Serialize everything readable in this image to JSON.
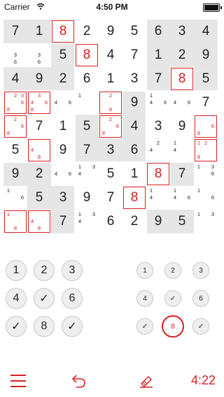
{
  "status": {
    "carrier": "Carrier",
    "time": "4:50 PM"
  },
  "board": {
    "rows": [
      [
        {
          "v": "7"
        },
        {
          "v": "1"
        },
        {
          "v": "8",
          "red": true,
          "sel": true
        },
        {
          "v": "2"
        },
        {
          "v": "9"
        },
        {
          "v": "5"
        },
        {
          "v": "6"
        },
        {
          "v": "3"
        },
        {
          "v": "4"
        }
      ],
      [
        {
          "n": [
            "",
            "",
            "",
            "",
            "3",
            "",
            "",
            "6",
            ""
          ]
        },
        {
          "n": [
            "",
            "",
            "",
            "",
            "3",
            "",
            "",
            "6",
            ""
          ]
        },
        {
          "v": "5"
        },
        {
          "v": "8",
          "red": true,
          "sel": true
        },
        {
          "v": "4"
        },
        {
          "v": "7"
        },
        {
          "v": "1"
        },
        {
          "v": "2"
        },
        {
          "v": "9"
        }
      ],
      [
        {
          "v": "4"
        },
        {
          "v": "9"
        },
        {
          "v": "2"
        },
        {
          "v": "6"
        },
        {
          "v": "1"
        },
        {
          "v": "3"
        },
        {
          "v": "7"
        },
        {
          "v": "8",
          "red": true,
          "sel": true
        },
        {
          "v": "5"
        }
      ],
      [
        {
          "n": [
            "",
            "2",
            "3",
            "",
            "",
            "6",
            "8",
            "",
            ""
          ],
          "red": true,
          "sel": true
        },
        {
          "n": [
            "",
            "3",
            "",
            "4",
            "",
            "6",
            "8",
            "",
            ""
          ],
          "red": true,
          "sel": true
        },
        {
          "n": [
            "",
            "",
            "",
            "4",
            "",
            "6",
            "",
            "",
            ""
          ]
        },
        {
          "n": [
            "1",
            "",
            "",
            "",
            "",
            "",
            "",
            "",
            ""
          ]
        },
        {
          "n": [
            "",
            "2",
            "",
            "",
            "",
            "",
            "",
            "8",
            ""
          ],
          "red": true,
          "sel": true
        },
        {
          "v": "9"
        },
        {
          "n": [
            "1",
            "",
            "",
            "4",
            "",
            "6",
            "",
            "",
            ""
          ]
        },
        {
          "n": [
            "",
            "",
            "",
            "4",
            "",
            "6",
            "",
            "",
            ""
          ]
        },
        {
          "v": "7"
        }
      ],
      [
        {
          "n": [
            "",
            "2",
            "",
            "",
            "",
            "6",
            "8",
            "",
            ""
          ],
          "red": true,
          "sel": true
        },
        {
          "v": "7"
        },
        {
          "v": "1"
        },
        {
          "v": "5"
        },
        {
          "n": [
            "",
            "2",
            "",
            "",
            "",
            "6",
            "8",
            "",
            ""
          ],
          "red": true,
          "sel": true
        },
        {
          "v": "4"
        },
        {
          "v": "3"
        },
        {
          "v": "9"
        },
        {
          "n": [
            "",
            "",
            "",
            "",
            "",
            "6",
            "8",
            "",
            ""
          ],
          "red": true,
          "sel": true
        }
      ],
      [
        {
          "v": "5"
        },
        {
          "n": [
            "",
            "",
            "",
            "4",
            "",
            "",
            "",
            "8",
            ""
          ],
          "red": true,
          "sel": true
        },
        {
          "v": "9"
        },
        {
          "v": "7"
        },
        {
          "v": "3"
        },
        {
          "v": "6"
        },
        {
          "n": [
            "",
            "2",
            "",
            "4",
            "",
            "",
            "",
            "",
            ""
          ]
        },
        {
          "n": [
            "1",
            "",
            "",
            "4",
            "",
            "",
            "",
            "",
            ""
          ]
        },
        {
          "n": [
            "1",
            "2",
            "",
            "",
            "",
            "",
            "8",
            "",
            ""
          ],
          "red": true,
          "sel": true
        }
      ],
      [
        {
          "v": "9"
        },
        {
          "v": "2"
        },
        {
          "n": [
            "",
            "",
            "",
            "4",
            "",
            "6",
            "",
            "",
            ""
          ]
        },
        {
          "n": [
            "1",
            "",
            "3",
            "4",
            "",
            "",
            "",
            "",
            ""
          ]
        },
        {
          "v": "5"
        },
        {
          "v": "1"
        },
        {
          "v": "8",
          "red": true,
          "sel": true
        },
        {
          "v": "7"
        },
        {
          "n": [
            "1",
            "",
            "3",
            "",
            "",
            "6",
            "",
            "",
            ""
          ]
        }
      ],
      [
        {
          "n": [
            "1",
            "",
            "",
            "",
            "",
            "6",
            "",
            "",
            ""
          ]
        },
        {
          "v": "5"
        },
        {
          "v": "3"
        },
        {
          "v": "9"
        },
        {
          "v": "7"
        },
        {
          "v": "8",
          "red": true,
          "sel": true
        },
        {
          "n": [
            "1",
            "",
            "",
            "4",
            "",
            "",
            "",
            "",
            ""
          ]
        },
        {
          "n": [
            "1",
            "",
            "",
            "4",
            "",
            "6",
            "",
            "",
            ""
          ]
        },
        {
          "n": [
            "1",
            "",
            "",
            "",
            "",
            "6",
            "",
            "",
            ""
          ]
        }
      ],
      [
        {
          "n": [
            "1",
            "",
            "",
            "",
            "",
            "",
            "",
            "8",
            ""
          ],
          "red": true,
          "sel": true
        },
        {
          "n": [
            "",
            "",
            "",
            "4",
            "",
            "",
            "",
            "8",
            ""
          ],
          "red": true,
          "sel": true
        },
        {
          "v": "7"
        },
        {
          "n": [
            "1",
            "",
            "3",
            "4",
            "",
            "",
            "",
            "",
            ""
          ]
        },
        {
          "v": "6"
        },
        {
          "v": "2"
        },
        {
          "v": "9"
        },
        {
          "v": "5"
        },
        {
          "n": [
            "1",
            "",
            "3",
            "",
            "",
            "",
            "",
            "",
            ""
          ]
        }
      ]
    ]
  },
  "pad_left": {
    "buttons": [
      "1",
      "2",
      "3",
      "4",
      "✓",
      "6",
      "✓",
      "8",
      "✓"
    ]
  },
  "pad_right": {
    "buttons": [
      "1",
      "2",
      "3",
      "4",
      "✓",
      "6",
      "✓",
      "8",
      "✓"
    ],
    "highlighted_index": 7
  },
  "toolbar": {
    "timer": "4:22",
    "icons": [
      "menu-icon",
      "undo-icon",
      "pencil-eraser-icon"
    ],
    "accent": "#d82020"
  }
}
